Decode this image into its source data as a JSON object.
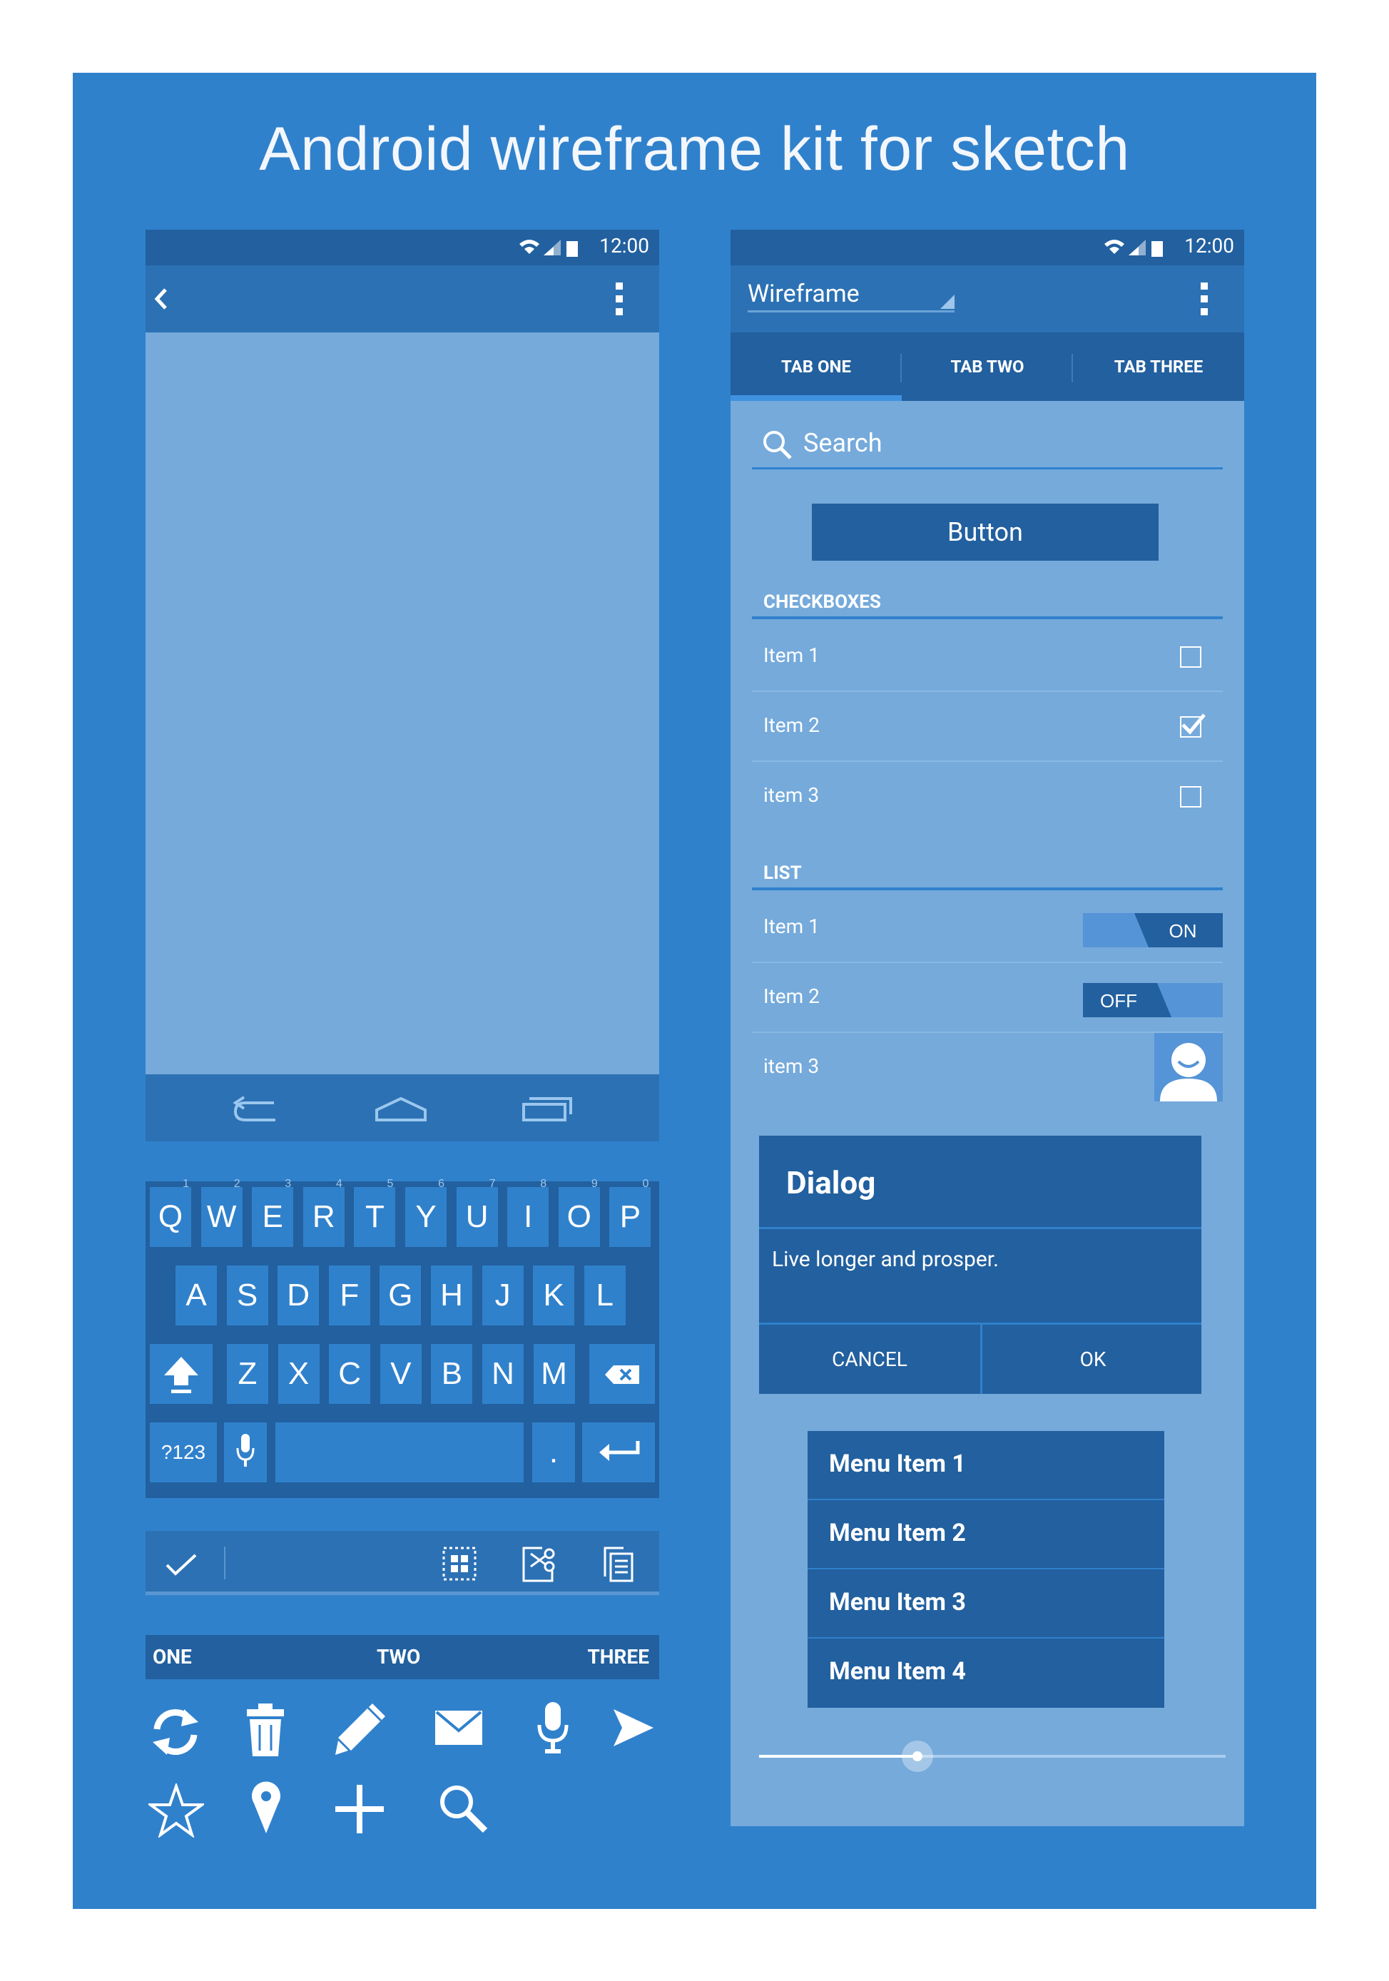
{
  "page": {
    "title": "Android wireframe kit for sketch",
    "background": "#3081cc"
  },
  "left_phone": {
    "status_time": "12:00",
    "back_icon": "chevron-left-icon",
    "overflow_icon": "overflow-menu-icon",
    "nav_icons": [
      "back-nav-icon",
      "home-nav-icon",
      "recents-nav-icon"
    ]
  },
  "keyboard": {
    "row1": [
      {
        "k": "Q",
        "h": "1"
      },
      {
        "k": "W",
        "h": "2"
      },
      {
        "k": "E",
        "h": "3"
      },
      {
        "k": "R",
        "h": "4"
      },
      {
        "k": "T",
        "h": "5"
      },
      {
        "k": "Y",
        "h": "6"
      },
      {
        "k": "U",
        "h": "7"
      },
      {
        "k": "I",
        "h": "8"
      },
      {
        "k": "O",
        "h": "9"
      },
      {
        "k": "P",
        "h": "0"
      }
    ],
    "row2": [
      "A",
      "S",
      "D",
      "F",
      "G",
      "H",
      "J",
      "K",
      "L"
    ],
    "row3": [
      "Z",
      "X",
      "C",
      "V",
      "B",
      "N",
      "M"
    ],
    "symbols_label": "?123",
    "period_label": "."
  },
  "contextual_bar": {
    "icons": [
      "check-icon",
      "select-all-icon",
      "cut-icon",
      "copy-icon"
    ]
  },
  "small_tabs": {
    "one": "ONE",
    "two": "TWO",
    "three": "THREE"
  },
  "icon_set": [
    "refresh-icon",
    "trash-icon",
    "pencil-icon",
    "mail-icon",
    "mic-icon",
    "send-icon",
    "star-icon",
    "location-pin-icon",
    "plus-icon",
    "search-icon"
  ],
  "right_phone": {
    "status_time": "12:00",
    "spinner_label": "Wireframe",
    "tabs": [
      "TAB ONE",
      "TAB TWO",
      "TAB THREE"
    ],
    "search_placeholder": "Search",
    "button_label": "Button",
    "checkboxes_header": "CHECKBOXES",
    "checkbox_items": [
      {
        "label": "Item 1",
        "checked": false
      },
      {
        "label": "Item 2",
        "checked": true
      },
      {
        "label": "item 3",
        "checked": false
      }
    ],
    "list_header": "LIST",
    "list_items": [
      {
        "label": "Item 1",
        "control": "toggle",
        "state": "ON"
      },
      {
        "label": "Item 2",
        "control": "toggle",
        "state": "OFF"
      },
      {
        "label": "item 3",
        "control": "avatar"
      }
    ],
    "dialog": {
      "title": "Dialog",
      "message": "Live longer and prosper.",
      "cancel": "CANCEL",
      "ok": "OK"
    },
    "menu_items": [
      "Menu Item 1",
      "Menu Item 2",
      "Menu Item 3",
      "Menu Item 4"
    ],
    "slider_value": 0.34
  }
}
